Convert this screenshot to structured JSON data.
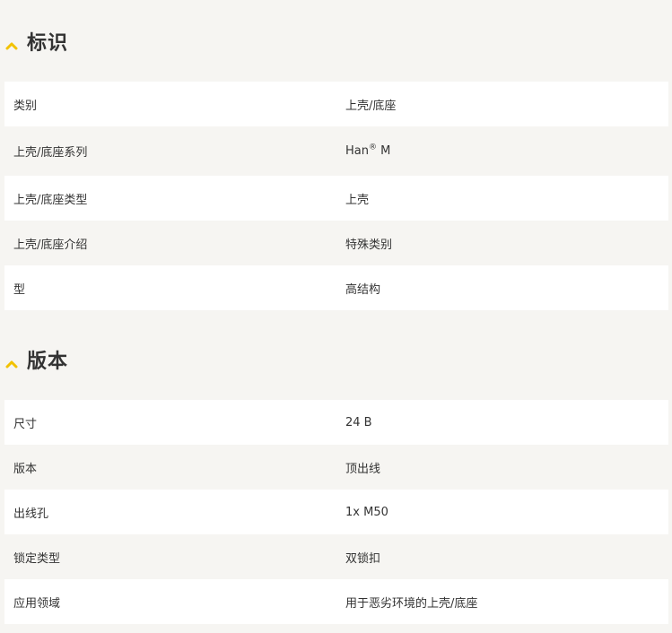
{
  "colors": {
    "page_background": "#f6f5f2",
    "row_white": "#ffffff",
    "row_gray": "#f6f5f2",
    "chevron": "#f2c200",
    "text": "#333333"
  },
  "identification": {
    "title": "标识",
    "icon": "chevron-up-icon",
    "rows": [
      {
        "label": "类别",
        "value": "上壳/底座"
      },
      {
        "label": "上壳/底座系列",
        "value": "Han",
        "value_sup": "®",
        "value_suffix": " M"
      },
      {
        "label": "上壳/底座类型",
        "value": "上壳"
      },
      {
        "label": "上壳/底座介绍",
        "value": "特殊类别"
      },
      {
        "label": "型",
        "value": "高结构"
      }
    ]
  },
  "version": {
    "title": "版本",
    "icon": "chevron-up-icon",
    "rows": [
      {
        "label": "尺寸",
        "value": "24 B"
      },
      {
        "label": "版本",
        "value": "顶出线"
      },
      {
        "label": "出线孔",
        "value": "1x M50"
      },
      {
        "label": "锁定类型",
        "value": "双锁扣"
      },
      {
        "label": "应用领域",
        "value": "用于恶劣环境的上壳/底座"
      }
    ]
  }
}
